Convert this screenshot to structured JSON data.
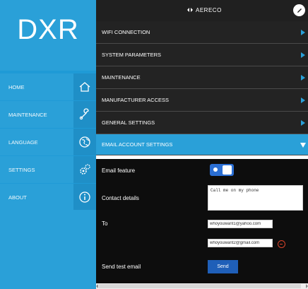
{
  "brand": {
    "title": "DXR"
  },
  "topbar": {
    "logo_text": "AERECO",
    "edit_icon": "pencil-icon"
  },
  "sidebar": {
    "items": [
      {
        "label": "HOME",
        "icon": "house-icon"
      },
      {
        "label": "MAINTENANCE",
        "icon": "wrench-icon"
      },
      {
        "label": "LANGUAGE",
        "icon": "globe-icon"
      },
      {
        "label": "SETTINGS",
        "icon": "gears-icon"
      },
      {
        "label": "ABOUT",
        "icon": "info-icon"
      }
    ]
  },
  "menu": {
    "items": [
      {
        "label": "WIFI CONNECTION"
      },
      {
        "label": "SYSTEM PARAMETERS"
      },
      {
        "label": "MAINTENANCE"
      },
      {
        "label": "MANUFACTURER ACCESS"
      },
      {
        "label": "GENERAL SETTINGS"
      },
      {
        "label": "EMAIL ACCOUNT SETTINGS"
      }
    ],
    "active_index": 5
  },
  "email_settings": {
    "feature_label": "Email feature",
    "feature_enabled": true,
    "contact_label": "Contact details",
    "contact_value": "Call me on my phone",
    "to_label": "To",
    "to_1": "whoyouwant1@yahoo.com",
    "to_2": "whoyouwant2@gmail.com",
    "send_test_label": "Send test email",
    "send_button": "Send"
  },
  "colors": {
    "sidebar_blue": "#2aa0d8",
    "menu_dark": "#232323",
    "panel_black": "#0d0d0d",
    "toggle_blue": "#2b6fd4",
    "remove_red": "#d9442b"
  }
}
